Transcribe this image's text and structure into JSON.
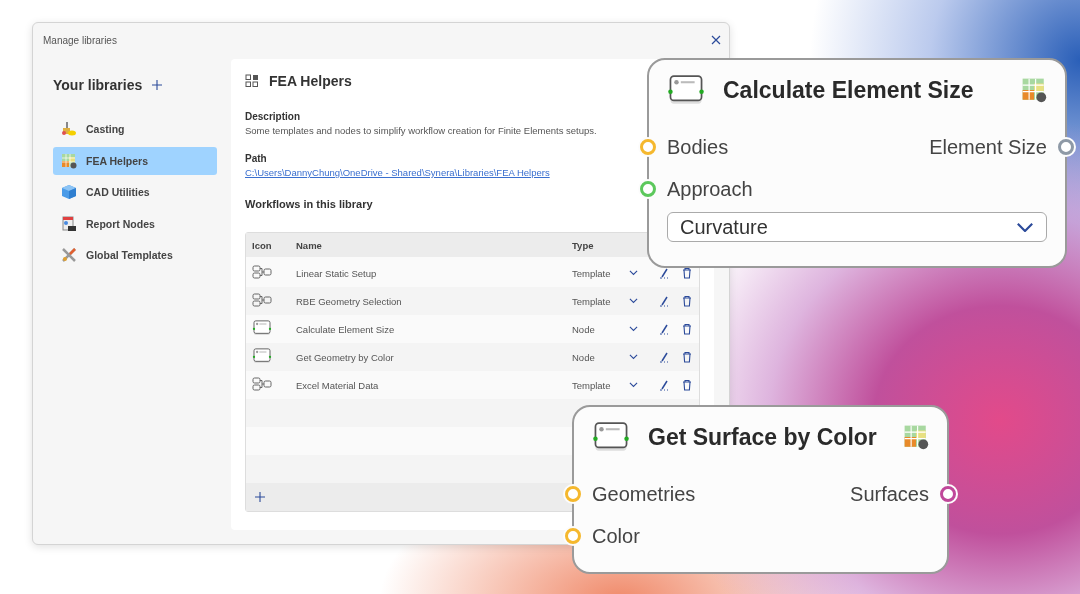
{
  "window": {
    "title": "Manage libraries"
  },
  "sidebar": {
    "heading": "Your libraries",
    "items": [
      {
        "label": "Casting",
        "selected": false
      },
      {
        "label": "FEA Helpers",
        "selected": true
      },
      {
        "label": "CAD Utilities",
        "selected": false
      },
      {
        "label": "Report Nodes",
        "selected": false
      },
      {
        "label": "Global Templates",
        "selected": false
      }
    ]
  },
  "library": {
    "title": "FEA Helpers",
    "description_label": "Description",
    "description": "Some templates and nodes to simplify workflow creation for Finite Elements setups.",
    "path_label": "Path",
    "path": "C:\\Users\\DannyChung\\OneDrive - Shared\\Synera\\Libraries\\FEA Helpers",
    "workflows_heading": "Workflows in this library",
    "table": {
      "columns": [
        "Icon",
        "Name",
        "Type"
      ],
      "rows": [
        {
          "kind": "template",
          "name": "Linear Static Setup",
          "type": "Template"
        },
        {
          "kind": "template",
          "name": "RBE Geometry Selection",
          "type": "Template"
        },
        {
          "kind": "node",
          "name": "Calculate Element Size",
          "type": "Node"
        },
        {
          "kind": "node",
          "name": "Get Geometry by Color",
          "type": "Node"
        },
        {
          "kind": "template",
          "name": "Excel Material Data",
          "type": "Template"
        }
      ]
    }
  },
  "nodes": [
    {
      "title": "Calculate Element Size",
      "inputs": [
        {
          "label": "Bodies",
          "color": "#f5b82e"
        },
        {
          "label": "Approach",
          "color": "#5cc85c"
        }
      ],
      "outputs": [
        {
          "label": "Element Size",
          "color": "#8e99a6"
        }
      ],
      "dropdown": {
        "value": "Curvature"
      }
    },
    {
      "title": "Get Surface by Color",
      "inputs": [
        {
          "label": "Geometries",
          "color": "#f5b82e"
        },
        {
          "label": "Color",
          "color": "#f5b82e"
        }
      ],
      "outputs": [
        {
          "label": "Surfaces",
          "color": "#c0489a"
        }
      ]
    }
  ]
}
